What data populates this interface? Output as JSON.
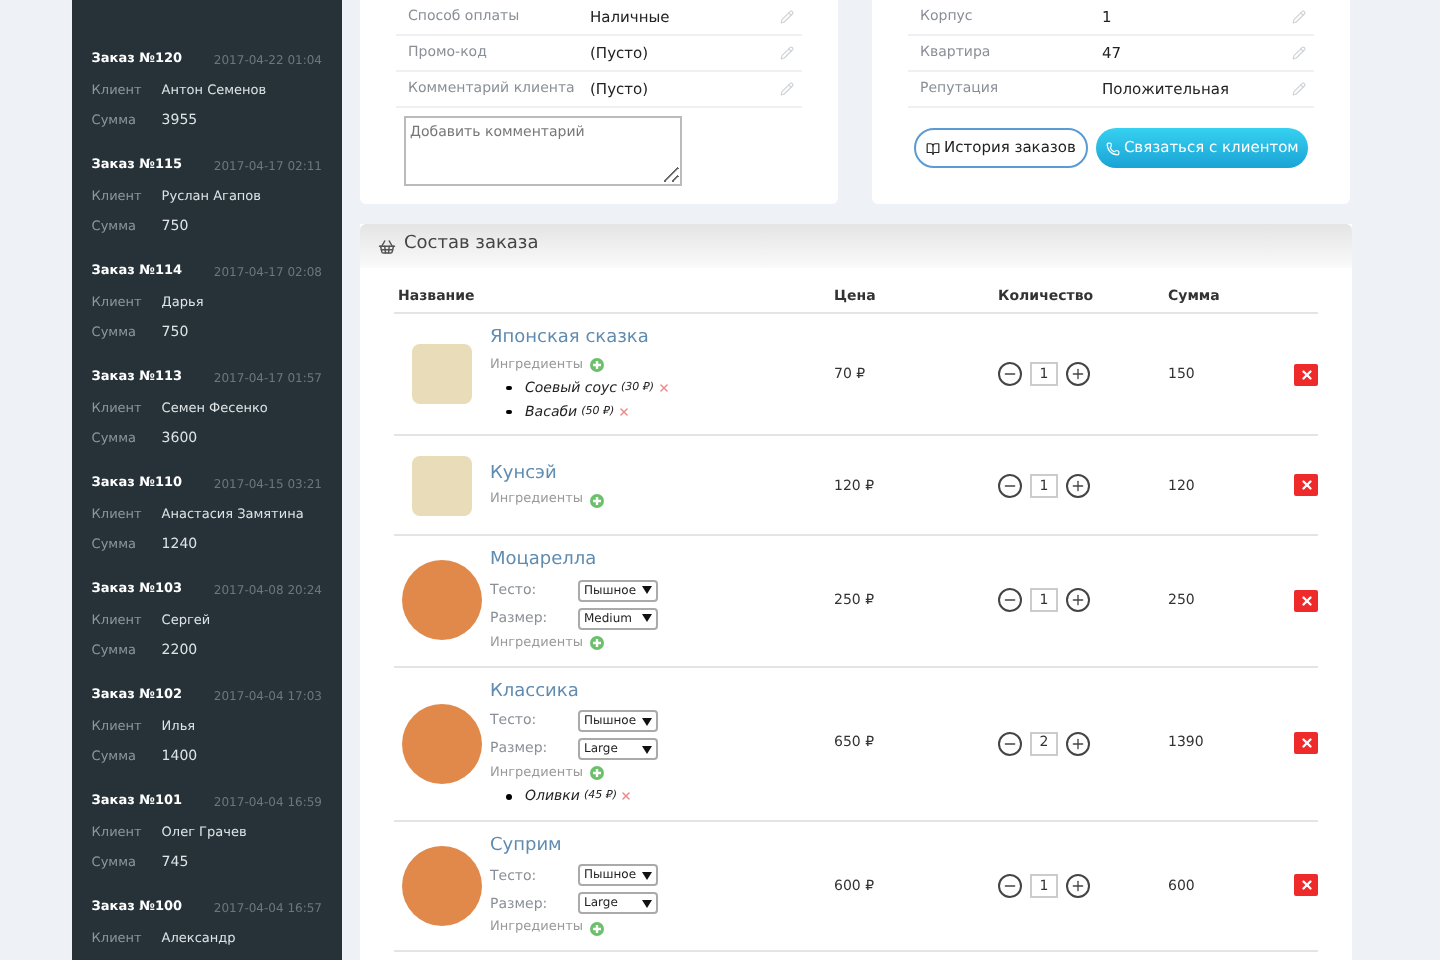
{
  "orders": [
    {
      "title": "Заказ №120",
      "date": "2017-04-22 01:04",
      "client_label": "Клиент",
      "client": "Антон Семенов",
      "sum_label": "Сумма",
      "sum": "3955"
    },
    {
      "title": "Заказ №115",
      "date": "2017-04-17 02:11",
      "client_label": "Клиент",
      "client": "Руслан Агапов",
      "sum_label": "Сумма",
      "sum": "750"
    },
    {
      "title": "Заказ №114",
      "date": "2017-04-17 02:08",
      "client_label": "Клиент",
      "client": "Дарья",
      "sum_label": "Сумма",
      "sum": "750"
    },
    {
      "title": "Заказ №113",
      "date": "2017-04-17 01:57",
      "client_label": "Клиент",
      "client": "Семен Фесенко",
      "sum_label": "Сумма",
      "sum": "3600"
    },
    {
      "title": "Заказ №110",
      "date": "2017-04-15 03:21",
      "client_label": "Клиент",
      "client": "Анастасия Замятина",
      "sum_label": "Сумма",
      "sum": "1240"
    },
    {
      "title": "Заказ №103",
      "date": "2017-04-08 20:24",
      "client_label": "Клиент",
      "client": "Сергей",
      "sum_label": "Сумма",
      "sum": "2200"
    },
    {
      "title": "Заказ №102",
      "date": "2017-04-04 17:03",
      "client_label": "Клиент",
      "client": "Илья",
      "sum_label": "Сумма",
      "sum": "1400"
    },
    {
      "title": "Заказ №101",
      "date": "2017-04-04 16:59",
      "client_label": "Клиент",
      "client": "Олег Грачев",
      "sum_label": "Сумма",
      "sum": "745"
    },
    {
      "title": "Заказ №100",
      "date": "2017-04-04 16:57",
      "client_label": "Клиент",
      "client": "Александр"
    }
  ],
  "order_info": {
    "fields": [
      {
        "label": "Способ оплаты",
        "value": "Наличные"
      },
      {
        "label": "Промо-код",
        "value": "(Пусто)"
      },
      {
        "label": "Комментарий клиента",
        "value": "(Пусто)"
      }
    ],
    "comment": {
      "placeholder": "Добавить комментарий"
    }
  },
  "client_info": {
    "fields": [
      {
        "label": "Корпус",
        "value": "1"
      },
      {
        "label": "Квартира",
        "value": "47"
      },
      {
        "label": "Репутация",
        "value": "Положительная"
      }
    ],
    "buttons": [
      {
        "label": "История заказов",
        "kind": "outline"
      },
      {
        "label": "Связаться с клиентом",
        "kind": "primary"
      }
    ]
  },
  "composition": {
    "title": "Состав заказа",
    "columns": [
      "Название",
      "Цена",
      "Количество",
      "Сумма"
    ],
    "rows": [
      {
        "name": "Японская сказка",
        "options": [],
        "ingredients_label": "Ингредиенты",
        "ingredients": [
          {
            "name": "Соевый соус",
            "price": "(30 ₽)"
          },
          {
            "name": "Васаби",
            "price": "(50 ₽)"
          }
        ],
        "price": "70 ₽",
        "quantity": "1",
        "sum": "150"
      },
      {
        "name": "Кунсэй",
        "options": [],
        "ingredients_label": "Ингредиенты",
        "ingredients": [],
        "price": "120 ₽",
        "quantity": "1",
        "sum": "120"
      },
      {
        "name": "Моцарелла",
        "options": [
          {
            "label": "Тесто:",
            "value": "Пышное"
          },
          {
            "label": "Размер:",
            "value": "Medium"
          }
        ],
        "ingredients_label": "Ингредиенты",
        "ingredients": [],
        "price": "250 ₽",
        "quantity": "1",
        "sum": "250"
      },
      {
        "name": "Классика",
        "options": [
          {
            "label": "Тесто:",
            "value": "Пышное"
          },
          {
            "label": "Размер:",
            "value": "Large"
          }
        ],
        "ingredients_label": "Ингредиенты",
        "ingredients": [
          {
            "name": "Оливки",
            "price": "(45 ₽)"
          }
        ],
        "price": "650 ₽",
        "quantity": "2",
        "sum": "1390"
      },
      {
        "name": "Суприм",
        "options": [
          {
            "label": "Тесто:",
            "value": "Пышное"
          },
          {
            "label": "Размер:",
            "value": "Large"
          }
        ],
        "ingredients_label": "Ингредиенты",
        "ingredients": [],
        "price": "600 ₽",
        "quantity": "1",
        "sum": "600"
      }
    ]
  }
}
